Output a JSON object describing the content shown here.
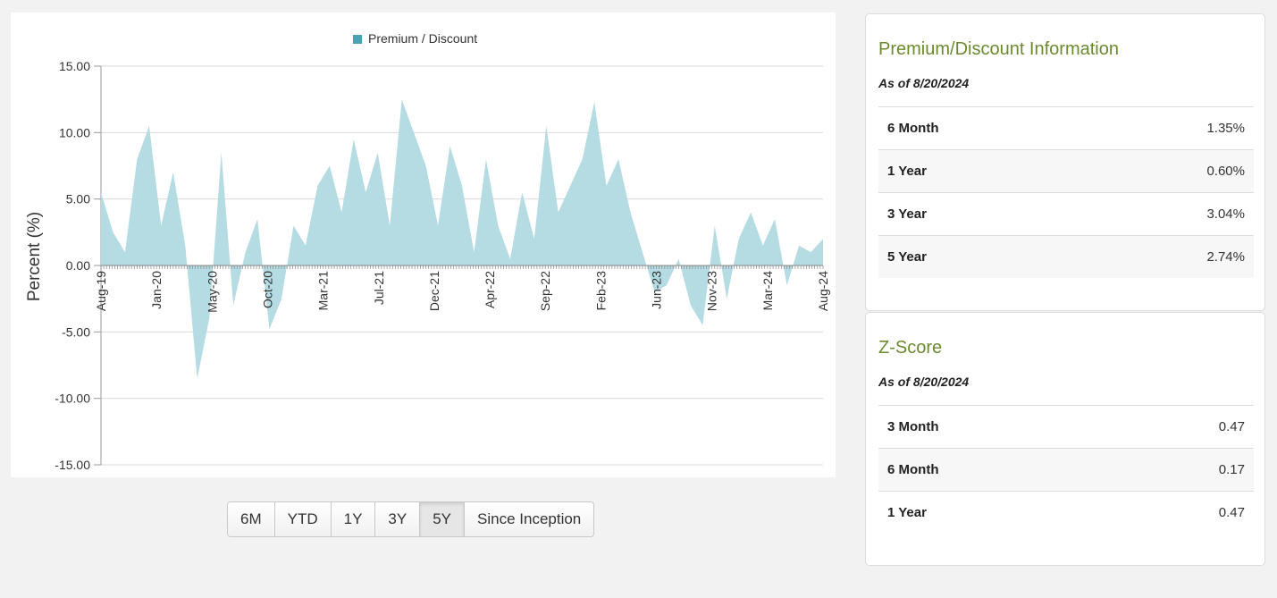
{
  "range_buttons": {
    "items": [
      "6M",
      "YTD",
      "1Y",
      "3Y",
      "5Y",
      "Since Inception"
    ],
    "active": "5Y"
  },
  "premium_discount_info": {
    "title": "Premium/Discount Information",
    "as_of": "As of 8/20/2024",
    "rows": [
      {
        "label": "6 Month",
        "value": "1.35%"
      },
      {
        "label": "1 Year",
        "value": "0.60%"
      },
      {
        "label": "3 Year",
        "value": "3.04%"
      },
      {
        "label": "5 Year",
        "value": "2.74%"
      }
    ]
  },
  "z_score": {
    "title": "Z-Score",
    "as_of": "As of 8/20/2024",
    "rows": [
      {
        "label": "3 Month",
        "value": "0.47"
      },
      {
        "label": "6 Month",
        "value": "0.17"
      },
      {
        "label": "1 Year",
        "value": "0.47"
      }
    ]
  },
  "colors": {
    "area_fill": "#b5dbe3",
    "legend_swatch": "#4aa3b5",
    "card_title": "#6b8a2e"
  },
  "chart_data": {
    "type": "area",
    "title": "",
    "ylabel": "Percent (%)",
    "legend": [
      "Premium / Discount"
    ],
    "legend_position": "top-center",
    "grid": true,
    "ylim": [
      -15,
      15
    ],
    "y_ticks": [
      "15.00",
      "10.00",
      "5.00",
      "0.00",
      "-5.00",
      "-10.00",
      "-15.00"
    ],
    "x_tick_labels": [
      "Aug-19",
      "Jan-20",
      "May-20",
      "Oct-20",
      "Mar-21",
      "Jul-21",
      "Dec-21",
      "Apr-22",
      "Sep-22",
      "Feb-23",
      "Jun-23",
      "Nov-23",
      "Mar-24",
      "Aug-24"
    ],
    "x_range": [
      "2019-08",
      "2024-08"
    ],
    "series": [
      {
        "name": "Premium / Discount",
        "x": [
          "2019-08",
          "2019-09",
          "2019-10",
          "2019-11",
          "2019-12",
          "2020-01",
          "2020-02",
          "2020-03",
          "2020-04",
          "2020-05",
          "2020-06",
          "2020-07",
          "2020-08",
          "2020-09",
          "2020-10",
          "2020-11",
          "2020-12",
          "2021-01",
          "2021-02",
          "2021-03",
          "2021-04",
          "2021-05",
          "2021-06",
          "2021-07",
          "2021-08",
          "2021-09",
          "2021-10",
          "2021-11",
          "2021-12",
          "2022-01",
          "2022-02",
          "2022-03",
          "2022-04",
          "2022-05",
          "2022-06",
          "2022-07",
          "2022-08",
          "2022-09",
          "2022-10",
          "2022-11",
          "2022-12",
          "2023-01",
          "2023-02",
          "2023-03",
          "2023-04",
          "2023-05",
          "2023-06",
          "2023-07",
          "2023-08",
          "2023-09",
          "2023-10",
          "2023-11",
          "2023-12",
          "2024-01",
          "2024-02",
          "2024-03",
          "2024-04",
          "2024-05",
          "2024-06",
          "2024-07",
          "2024-08"
        ],
        "values": [
          5.5,
          2.5,
          1.0,
          8.0,
          10.5,
          3.0,
          7.0,
          1.5,
          -8.5,
          -4.0,
          8.5,
          -3.0,
          1.0,
          3.5,
          -4.8,
          -2.5,
          3.0,
          1.5,
          6.0,
          7.5,
          4.0,
          9.5,
          5.5,
          8.5,
          3.0,
          12.5,
          10.0,
          7.5,
          3.0,
          9.0,
          6.0,
          1.0,
          8.0,
          3.0,
          0.5,
          5.5,
          2.0,
          10.5,
          4.0,
          6.0,
          8.0,
          12.3,
          6.0,
          8.0,
          4.0,
          1.0,
          -2.0,
          -1.5,
          0.5,
          -3.0,
          -4.5,
          3.0,
          -2.5,
          2.0,
          4.0,
          1.5,
          3.5,
          -1.5,
          1.5,
          1.0,
          2.0
        ]
      }
    ]
  }
}
